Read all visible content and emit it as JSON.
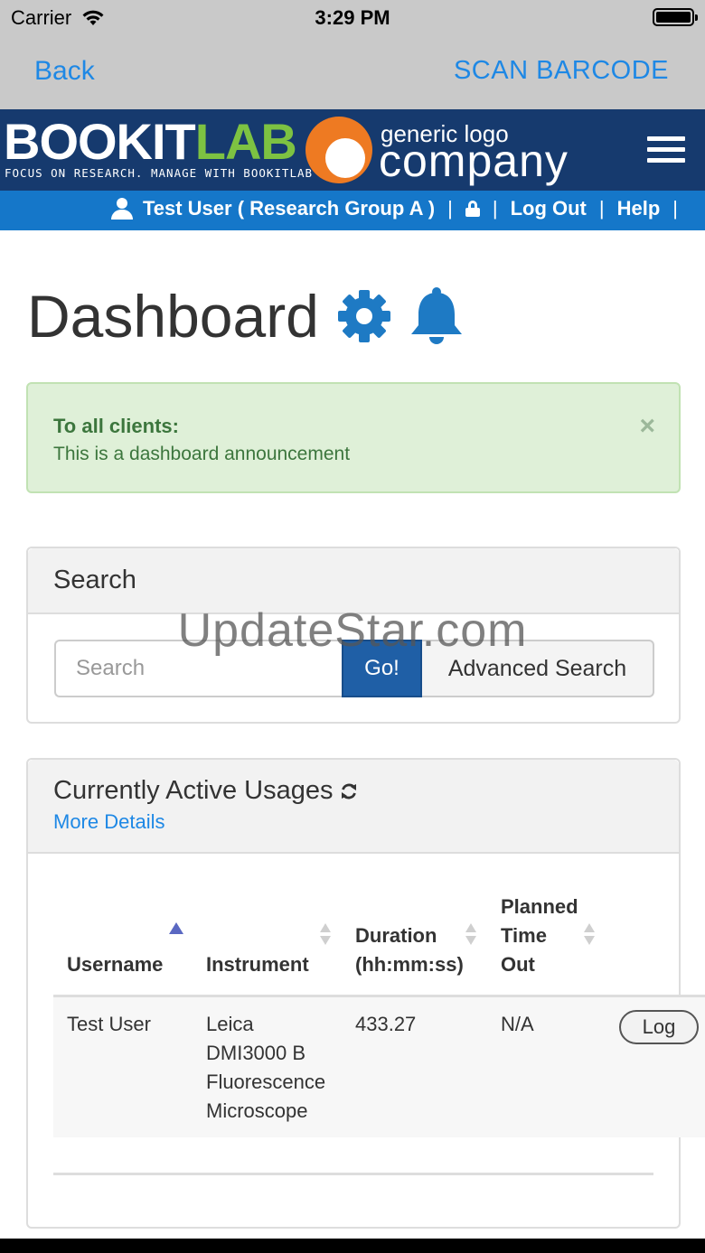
{
  "status": {
    "carrier": "Carrier",
    "time": "3:29 PM"
  },
  "nav": {
    "back_label": "Back",
    "scan_label": "SCAN BARCODE"
  },
  "brand": {
    "logo_book": "BOOKIT",
    "logo_lab": "LAB",
    "logo_tagline": "FOCUS ON RESEARCH. MANAGE WITH BOOKITLAB",
    "company_small": "generic logo",
    "company_big": "company",
    "colors": {
      "header": "#163a6e",
      "accent_green": "#7dc242",
      "accent_orange": "#ee7a22"
    }
  },
  "userbar": {
    "user_label": "Test User ( Research Group A )",
    "logout_label": "Log Out",
    "help_label": "Help",
    "separator": "|",
    "icons": [
      "user-icon",
      "lock-icon"
    ]
  },
  "page": {
    "title": "Dashboard",
    "icons": [
      "gear-icon",
      "bell-icon"
    ]
  },
  "alert": {
    "title": "To all clients:",
    "body": "This is a dashboard announcement",
    "close_glyph": "×"
  },
  "search": {
    "heading": "Search",
    "placeholder": "Search",
    "go_label": "Go!",
    "advanced_label": "Advanced Search",
    "watermark": "UpdateStar.com"
  },
  "usages": {
    "heading": "Currently Active Usages",
    "refresh_icon": "refresh-icon",
    "more_details": "More Details",
    "columns": {
      "username": "Username",
      "instrument": "Instrument",
      "duration_line1": "Duration",
      "duration_line2": "(hh:mm:ss)",
      "planned_line1": "Planned",
      "planned_line2": "Time",
      "planned_line3": "Out"
    },
    "rows": [
      {
        "username": "Test User",
        "instrument_line1": "Leica",
        "instrument_line2": "DMI3000 B",
        "instrument_line3": "Fluorescence",
        "instrument_line4": "Microscope",
        "duration": "433.27",
        "planned_time_out": "N/A",
        "action_label": "Log"
      }
    ]
  }
}
